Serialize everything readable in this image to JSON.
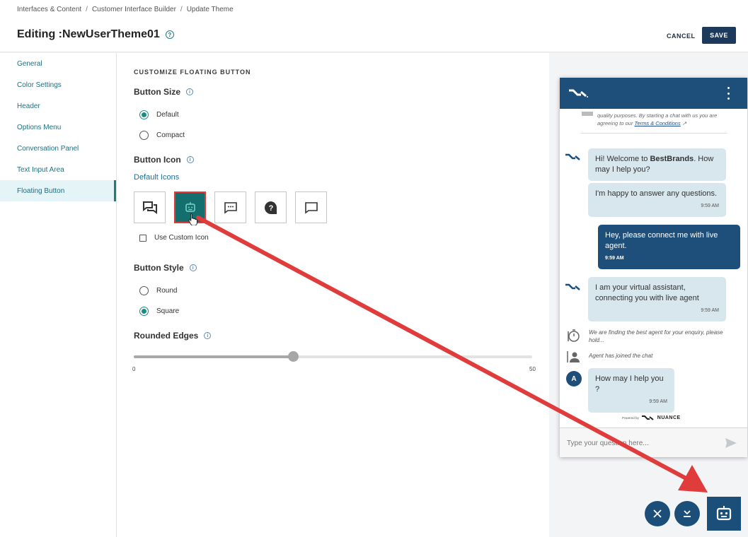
{
  "breadcrumb": [
    "Interfaces & Content",
    "Customer Interface Builder",
    "Update Theme"
  ],
  "page_title": "Editing :NewUserTheme01",
  "actions": {
    "cancel": "CANCEL",
    "save": "SAVE"
  },
  "sidebar": {
    "items": [
      {
        "label": "General"
      },
      {
        "label": "Color Settings"
      },
      {
        "label": "Header"
      },
      {
        "label": "Options Menu"
      },
      {
        "label": "Conversation Panel"
      },
      {
        "label": "Text Input Area"
      },
      {
        "label": "Floating Button",
        "active": true
      }
    ]
  },
  "settings": {
    "section_title": "CUSTOMIZE FLOATING BUTTON",
    "button_size": {
      "label": "Button Size",
      "options": [
        "Default",
        "Compact"
      ],
      "selected": "Default"
    },
    "button_icon": {
      "label": "Button Icon",
      "default_icons_label": "Default Icons",
      "icons": [
        "chat-bubbles-icon",
        "robot-icon",
        "chat-dots-icon",
        "help-bubble-icon",
        "chat-bubble-icon"
      ],
      "selected": "robot-icon",
      "custom_icon_label": "Use Custom Icon",
      "custom_icon_checked": false
    },
    "button_style": {
      "label": "Button Style",
      "options": [
        "Round",
        "Square"
      ],
      "selected": "Square"
    },
    "rounded_edges": {
      "label": "Rounded Edges",
      "min": "0",
      "max": "50",
      "value": 20
    }
  },
  "preview": {
    "disclaimer_text": "quality purposes. By starting a chat with us you are agreeing to our",
    "terms_link": "Terms & Conditions",
    "messages": {
      "welcome_pre": "Hi! Welcome to ",
      "welcome_brand": "BestBrands",
      "welcome_post": ". How may I help you?",
      "happy": "I'm happy to answer any questions.",
      "happy_time": "9:59 AM",
      "user_msg": "Hey, please connect me with live agent.",
      "user_time": "9:59 AM",
      "assistant": "I am your virtual assistant, connecting you with live agent",
      "assistant_time": "9:59 AM",
      "finding": "We are finding the best agent for your enquiry, please hold...",
      "joined": "Agent has joined the chat",
      "agent_initial": "A",
      "agent_msg": "How may I help you ?",
      "agent_time": "9:59 AM"
    },
    "powered_by": "Powered by",
    "brand": "NUANCE",
    "input_placeholder": "Type your question here...",
    "colors": {
      "header": "#1d4f7a",
      "bot_bubble": "#d8e6ee",
      "accent": "#1b8c82",
      "arrow": "#e23a3a"
    }
  }
}
